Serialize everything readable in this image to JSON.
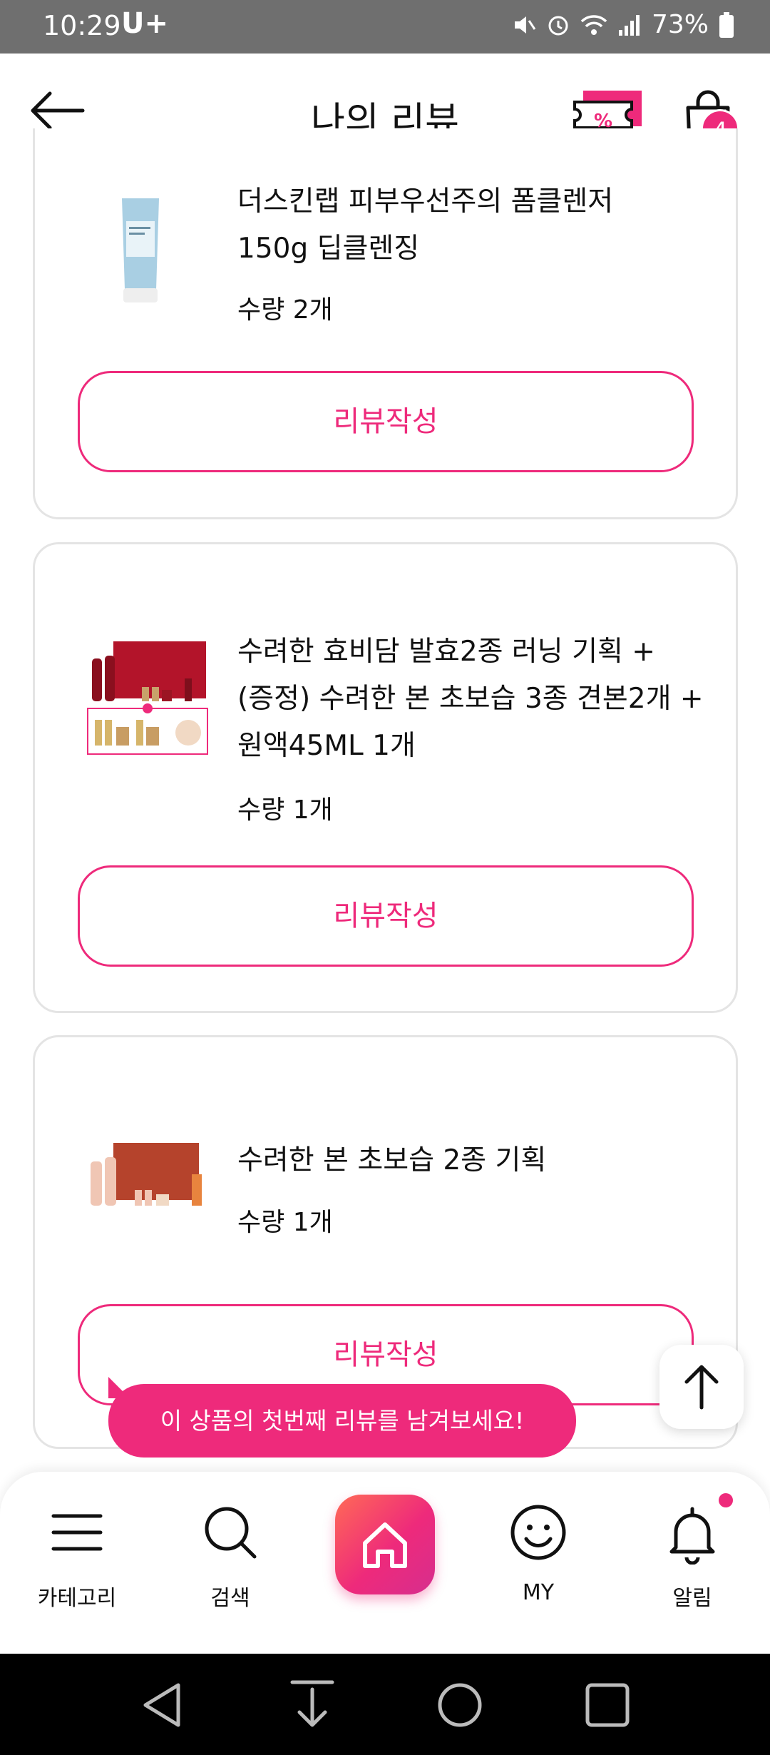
{
  "status_bar": {
    "time": "10:29",
    "carrier": "U+",
    "battery": "73%"
  },
  "header": {
    "title": "나의 리뷰",
    "cart_count": "4"
  },
  "products": [
    {
      "name_line1": "더스킨랩 피부우선주의 폼클렌저",
      "name_line2": "150g 딥클렌징",
      "name_line3": "",
      "qty_label": "수량",
      "qty": "2개",
      "button": "리뷰작성"
    },
    {
      "name_line1": "수려한 효비담 발효2종 러닝 기획 +",
      "name_line2": "(증정) 수려한 본 초보습 3종 견본2개 +",
      "name_line3": "원액45ML 1개",
      "qty_label": "수량",
      "qty": "1개",
      "button": "리뷰작성"
    },
    {
      "name_line1": "수려한 본 초보습 2종 기획",
      "name_line2": "",
      "name_line3": "",
      "qty_label": "수량",
      "qty": "1개",
      "button": "리뷰작성"
    }
  ],
  "tooltip": "이 상품의 첫번째 리뷰를 남겨보세요!",
  "bottom_nav": [
    {
      "label": "카테고리",
      "icon": "menu-icon"
    },
    {
      "label": "검색",
      "icon": "search-icon"
    },
    {
      "label": "",
      "icon": "home-icon"
    },
    {
      "label": "MY",
      "icon": "smiley-icon"
    },
    {
      "label": "알림",
      "icon": "bell-icon"
    }
  ],
  "colors": {
    "accent": "#ee2a7b",
    "status_bar": "#6f6f6f"
  }
}
